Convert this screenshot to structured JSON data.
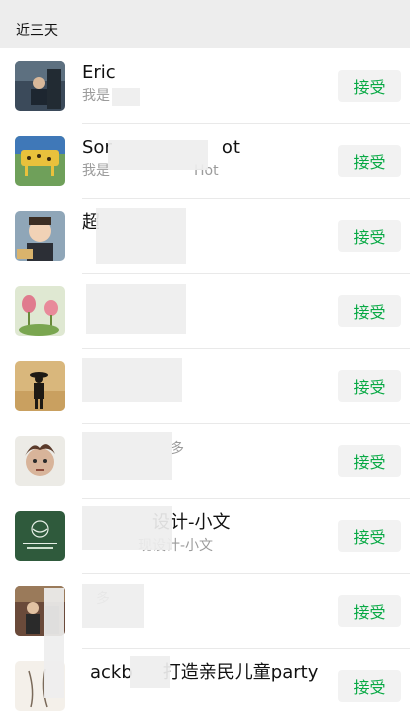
{
  "section": {
    "title": "近三天"
  },
  "requests": [
    {
      "name": "Eric",
      "message": "我是",
      "accept_label": "接受"
    },
    {
      "name": "Sor",
      "name_tail": "ot",
      "message": "我是",
      "message_tail": "Hot",
      "accept_label": "接受"
    },
    {
      "name": "超",
      "message": "",
      "accept_label": "接受"
    },
    {
      "name": "",
      "message": "",
      "accept_label": "接受"
    },
    {
      "name": "",
      "message": "",
      "accept_label": "接受"
    },
    {
      "name": "",
      "message": "多",
      "accept_label": "接受"
    },
    {
      "name": "设计-小文",
      "message": "现设计-小文",
      "accept_label": "接受"
    },
    {
      "name": "",
      "message": "多",
      "accept_label": "接受"
    },
    {
      "name": "ackb",
      "name_tail": "打造亲民儿童party",
      "message": "",
      "accept_label": "接受"
    }
  ],
  "colors": {
    "accept_text": "#07a944",
    "accept_bg": "#f2f2f2",
    "header_bg": "#ededed"
  },
  "icons": [
    "avatar-photo"
  ]
}
